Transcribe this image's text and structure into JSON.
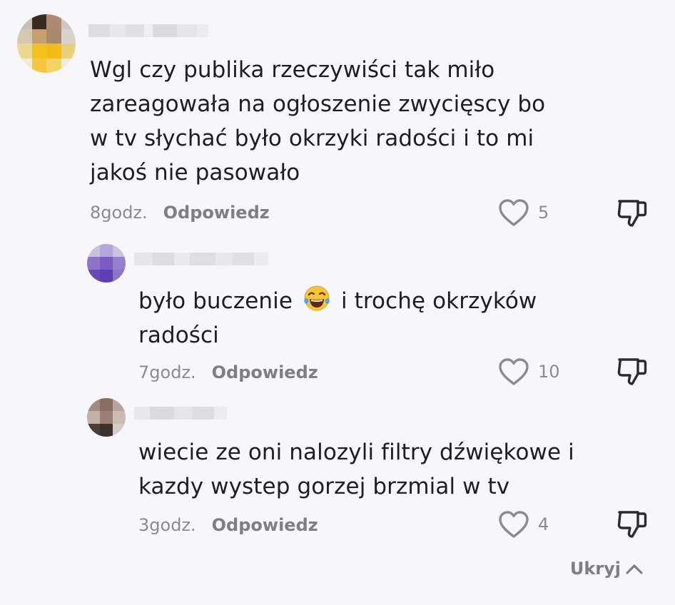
{
  "comments": [
    {
      "text_lines": [
        "Wgl czy publika rzeczywiści tak miło",
        "zareagowała na ogłoszenie zwycięscy bo",
        "w tv słychać było okrzyki radości i to mi",
        "jakoś nie pasowało"
      ],
      "time": "8godz.",
      "reply_label": "Odpowiedz",
      "likes": "5"
    },
    {
      "text_before_emoji": "było buczenie",
      "emoji": "face-with-tears-of-joy",
      "text_after_emoji": "i trochę okrzyków",
      "text_line2": "radości",
      "time": "7godz.",
      "reply_label": "Odpowiedz",
      "likes": "10"
    },
    {
      "text_lines": [
        "wiecie ze oni nalozyli filtry dźwiękowe i",
        "kazdy wystep gorzej brzmial w tv"
      ],
      "time": "3godz.",
      "reply_label": "Odpowiedz",
      "likes": "4"
    }
  ],
  "hide_replies_label": "Ukryj",
  "colors": {
    "background": "#f7f6fa",
    "text": "#1e1e22",
    "muted": "#8a8a92"
  }
}
